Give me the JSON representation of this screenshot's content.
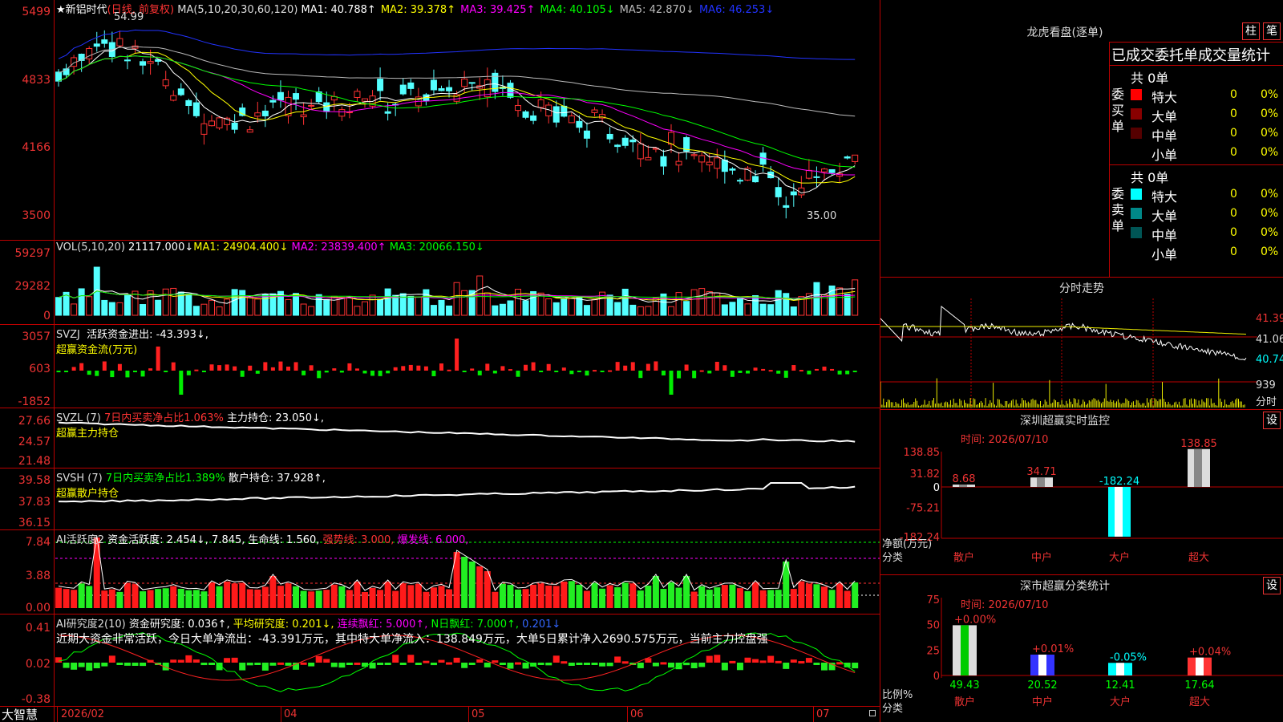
{
  "stock": {
    "name": "新铝时代",
    "period": "(日线, 前复权)",
    "star": "★"
  },
  "main": {
    "ma_label": "MA(5,10,20,30,60,120)",
    "ma_values": [
      {
        "name": "MA1:",
        "value": "40.788↑",
        "color": "#ffffff"
      },
      {
        "name": "MA2:",
        "value": "39.378↑",
        "color": "#ffff00"
      },
      {
        "name": "MA3:",
        "value": "39.425↑",
        "color": "#ff00ff"
      },
      {
        "name": "MA4:",
        "value": "40.105↓",
        "color": "#00ff00"
      },
      {
        "name": "MA5:",
        "value": "42.870↓",
        "color": "#bbbbbb"
      },
      {
        "name": "MA6:",
        "value": "46.253↓",
        "color": "#2233ff"
      }
    ],
    "y_labels": [
      "5499",
      "4833",
      "4166",
      "3500"
    ],
    "high_mark": "54.99",
    "low_mark": "35.00"
  },
  "vol": {
    "label": "VOL(5,10,20)",
    "value": "21117.000↓",
    "ma1": "MA1: 24904.400↓",
    "ma2": "MA2: 23839.400↑",
    "ma3": "MA3: 20066.150↓",
    "y_labels": [
      "59297",
      "29282",
      "0"
    ]
  },
  "svzj": {
    "label": "SVZJ",
    "desc": "活跃资金进出: -43.393↓,",
    "sub": "超赢资金流(万元)",
    "y_labels": [
      "3057",
      "603",
      "-1852"
    ]
  },
  "svzl": {
    "label": "SVZL (7)",
    "desc": "7日内买卖净占比1.063%",
    "desc2": "主力持仓: 23.050↓,",
    "sub": "超赢主力持仓",
    "y_labels": [
      "27.66",
      "24.57",
      "21.48"
    ]
  },
  "svsh": {
    "label": "SVSH (7)",
    "desc": "7日内买卖净占比1.389%",
    "desc2": "散户持仓: 37.928↑,",
    "sub": "超赢散户持仓",
    "y_labels": [
      "39.58",
      "37.83",
      "36.15"
    ]
  },
  "ai1": {
    "label": "AI活跃度2",
    "p1": "资金活跃度: 2.454↓,",
    "p2": "7.845,",
    "p3": "生命线: 1.560,",
    "p4": "强势线: 3.000,",
    "p5": "爆发线: 6.000,",
    "y_labels": [
      "7.84",
      "3.88",
      "0.00"
    ]
  },
  "ai2": {
    "label": "AI研究度2(10)",
    "p1": "资金研究度: 0.036↑,",
    "p2": "平均研究度: 0.201↓,",
    "p3": "连续飘红: 5.000↑,",
    "p4": "N日飘红: 7.000↑,",
    "p5": "0.201↓",
    "note": "近期大资金非常活跃，今日大单净流出：-43.391万元，其中特大单净流入：138.849万元，大单5日累计净入2690.575万元，当前主力控盘强",
    "y_labels": [
      "0.41",
      "0.02",
      "-0.38"
    ]
  },
  "xaxis": {
    "brand": "大智慧",
    "labels": [
      "2026/02",
      "04",
      "05",
      "06",
      "07"
    ]
  },
  "lhb": {
    "title": "龙虎看盘(逐单)",
    "btn1": "柱",
    "btn2": "笔",
    "stat_title": "已成交委托单成交量统计",
    "buy": {
      "side": "委买单",
      "total": "共 0单",
      "rows": [
        {
          "name": "特大",
          "count": "0",
          "pct": "0%",
          "color": "#ff0000"
        },
        {
          "name": "大单",
          "count": "0",
          "pct": "0%",
          "color": "#880000"
        },
        {
          "name": "中单",
          "count": "0",
          "pct": "0%",
          "color": "#550000"
        },
        {
          "name": "小单",
          "count": "0",
          "pct": "0%",
          "color": ""
        }
      ]
    },
    "sell": {
      "side": "委卖单",
      "total": "共 0单",
      "rows": [
        {
          "name": "特大",
          "count": "0",
          "pct": "0%",
          "color": "#00ffff"
        },
        {
          "name": "大单",
          "count": "0",
          "pct": "0%",
          "color": "#008888"
        },
        {
          "name": "中单",
          "count": "0",
          "pct": "0%",
          "color": "#005555"
        },
        {
          "name": "小单",
          "count": "0",
          "pct": "0%",
          "color": ""
        }
      ]
    }
  },
  "intraday": {
    "title": "分时走势",
    "y_labels": [
      "41.39",
      "41.06",
      "40.74"
    ],
    "vol_label": "939",
    "time_label": "分时"
  },
  "sz_monitor": {
    "title": "深圳超赢实时监控",
    "btn": "设",
    "time": "时间: 2026/07/10",
    "y_labels": [
      "138.85",
      "31.82",
      "0",
      "-75.21",
      "-182.24"
    ],
    "unit": "净额(万元)",
    "cat_label": "分类",
    "categories": [
      "散户",
      "中户",
      "大户",
      "超大"
    ]
  },
  "sz_class": {
    "title": "深市超赢分类统计",
    "btn": "设",
    "time": "时间: 2026/07/10",
    "y_labels": [
      "75",
      "50",
      "25",
      "0"
    ],
    "unit": "比例%",
    "cat_label": "分类",
    "categories": [
      "散户",
      "中户",
      "大户",
      "超大"
    ]
  },
  "chart_data": [
    {
      "type": "bar",
      "title": "深圳超赢实时监控",
      "categories": [
        "散户",
        "中户",
        "大户",
        "超大"
      ],
      "values": [
        8.68,
        34.71,
        -182.24,
        138.85
      ],
      "ylim": [
        -182.24,
        138.85
      ],
      "data_labels": [
        "8.68",
        "34.71",
        "-182.24",
        "138.85"
      ]
    },
    {
      "type": "bar",
      "title": "深市超赢分类统计",
      "categories": [
        "散户",
        "中户",
        "大户",
        "超大"
      ],
      "values": [
        49.43,
        20.52,
        12.41,
        17.64
      ],
      "change_labels": [
        "+0.00%",
        "+0.01%",
        "-0.05%",
        "+0.04%"
      ],
      "value_labels": [
        "49.43",
        "20.52",
        "12.41",
        "17.64"
      ],
      "ylim": [
        0,
        75
      ]
    }
  ]
}
